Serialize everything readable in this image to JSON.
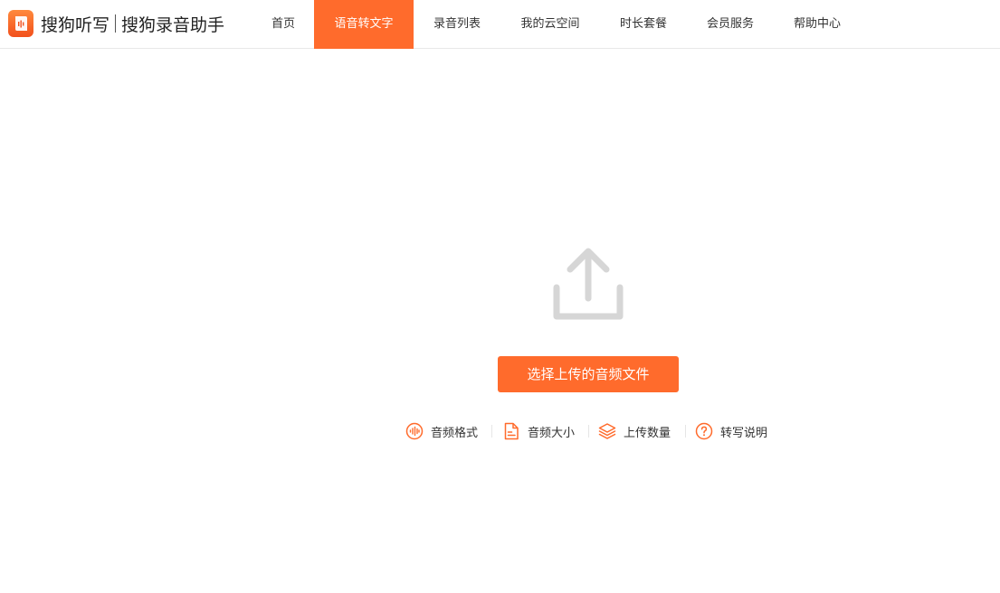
{
  "app": {
    "brand_primary": "搜狗听写",
    "brand_secondary": "搜狗录音助手",
    "accent_color": "#ff6b2c"
  },
  "nav": {
    "items": [
      {
        "label": "首页",
        "active": false
      },
      {
        "label": "语音转文字",
        "active": true
      },
      {
        "label": "录音列表",
        "active": false
      },
      {
        "label": "我的云空间",
        "active": false
      },
      {
        "label": "时长套餐",
        "active": false
      },
      {
        "label": "会员服务",
        "active": false
      },
      {
        "label": "帮助中心",
        "active": false
      }
    ]
  },
  "upload": {
    "icon": "upload-icon",
    "button_label": "选择上传的音频文件"
  },
  "info": {
    "items": [
      {
        "label": "音频格式",
        "icon": "waveform-icon"
      },
      {
        "label": "音频大小",
        "icon": "file-icon"
      },
      {
        "label": "上传数量",
        "icon": "layers-icon"
      },
      {
        "label": "转写说明",
        "icon": "help-circle-icon"
      }
    ]
  }
}
